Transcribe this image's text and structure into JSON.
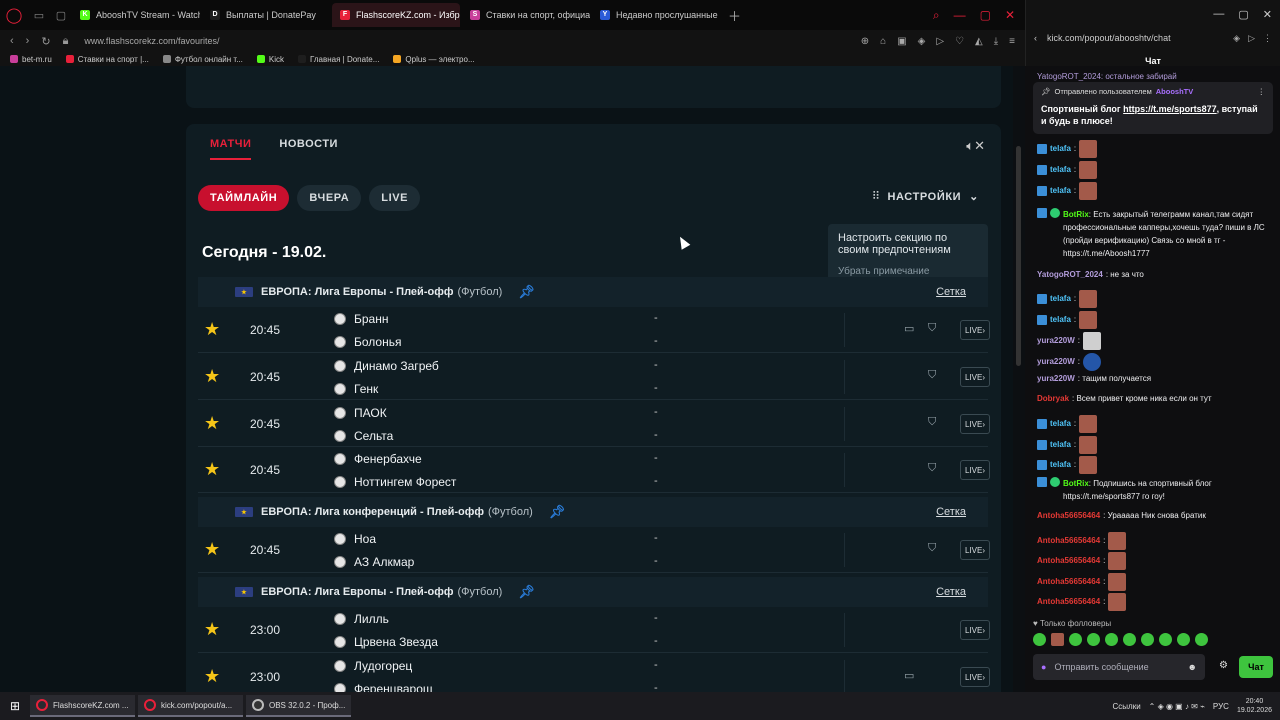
{
  "browser": {
    "tabs": [
      {
        "label": "AbooshTV Stream - Watch",
        "color": "#53fc18",
        "fav": "K"
      },
      {
        "label": "Выплаты | DonatePay",
        "color": "#1e1e1e",
        "fav": "D"
      },
      {
        "label": "FlashscoreKZ.com - Избр",
        "color": "#e8203a",
        "fav": "F",
        "active": true
      },
      {
        "label": "Ставки на спорт, официа",
        "color": "#c83e9a",
        "fav": "S"
      },
      {
        "label": "Недавно прослушанные",
        "color": "#2a5bd8",
        "fav": "Y"
      }
    ],
    "url": "www.flashscorekz.com/favourites/",
    "bookmarks": [
      {
        "label": "bet-m.ru",
        "color": "#c83e9a"
      },
      {
        "label": "Ставки на спорт |...",
        "color": "#e8203a"
      },
      {
        "label": "Футбол онлайн т...",
        "color": "#888888"
      },
      {
        "label": "Kick",
        "color": "#53fc18"
      },
      {
        "label": "Главная | Donate...",
        "color": "#1e1e1e"
      },
      {
        "label": "Qplus — электро...",
        "color": "#f5a623"
      }
    ]
  },
  "chat_window": {
    "url": "kick.com/popout/abooshtv/chat",
    "title": "Чат"
  },
  "page": {
    "main_tabs": [
      "МАТЧИ",
      "НОВОСТИ"
    ],
    "pills": [
      "ТАЙМЛАЙН",
      "ВЧЕРА",
      "LIVE"
    ],
    "settings_label": "НАСТРОЙКИ",
    "tooltip": {
      "text": "Настроить секцию по своим предпочтениям",
      "dismiss": "Убрать примечание"
    },
    "date": "Сегодня - 19.02.",
    "grid_label": "Сетка",
    "live_label": "LIVE",
    "leagues": [
      {
        "name": "ЕВРОПА: Лига Европы - Плей-офф",
        "sport": "(Футбол)"
      },
      {
        "name": "ЕВРОПА: Лига конференций - Плей-офф",
        "sport": "(Футбол)"
      },
      {
        "name": "ЕВРОПА: Лига Европы - Плей-офф",
        "sport": "(Футбол)"
      }
    ],
    "matches": [
      {
        "time": "20:45",
        "home": "Бранн",
        "away": "Болонья",
        "s1": "-",
        "s2": "-",
        "tv": true,
        "shirt": true
      },
      {
        "time": "20:45",
        "home": "Динамо Загреб",
        "away": "Генк",
        "s1": "-",
        "s2": "-",
        "tv": false,
        "shirt": true
      },
      {
        "time": "20:45",
        "home": "ПАОК",
        "away": "Сельта",
        "s1": "-",
        "s2": "-",
        "tv": false,
        "shirt": true
      },
      {
        "time": "20:45",
        "home": "Фенербахче",
        "away": "Ноттингем Форест",
        "s1": "-",
        "s2": "-",
        "tv": false,
        "shirt": true
      },
      {
        "time": "20:45",
        "home": "Ноа",
        "away": "АЗ Алкмар",
        "s1": "-",
        "s2": "-",
        "tv": false,
        "shirt": true
      },
      {
        "time": "23:00",
        "home": "Лилль",
        "away": "Црвена Звезда",
        "s1": "-",
        "s2": "-",
        "tv": false,
        "shirt": false
      },
      {
        "time": "23:00",
        "home": "Лудогорец",
        "away": "Ференцварош",
        "s1": "-",
        "s2": "-",
        "tv": true,
        "shirt": false
      }
    ]
  },
  "chat": {
    "pinned_header": "Отправлено пользователем",
    "pinned_user": "AbooshTV",
    "pinned_text": "Спортивный блог",
    "pinned_link": "https://t.me/sports877",
    "pinned_tail": ", вступай и будь в плюсе!",
    "messages": [
      {
        "user": "telafa",
        "color": "#4fc3f7",
        "text": ":",
        "emote": "r"
      },
      {
        "user": "telafa",
        "color": "#4fc3f7",
        "text": ":",
        "emote": "r"
      },
      {
        "user": "telafa",
        "color": "#4fc3f7",
        "text": ":",
        "emote": "r"
      },
      {
        "user": "BotRix",
        "color": "#53fc18",
        "text": ": Есть закрытый телеграмм канал,там сидят профессиональные капперы,хочешь туда? пиши в ЛС (пройди верификацию) Связь со мной в тг - https://t.me/Aboosh1777"
      },
      {
        "user": "YatogoROT_2024",
        "color": "#b39ddb",
        "text": ": не за что"
      },
      {
        "user": "telafa",
        "color": "#4fc3f7",
        "text": ":",
        "emote": "r"
      },
      {
        "user": "telafa",
        "color": "#4fc3f7",
        "text": ":",
        "emote": "r"
      },
      {
        "user": "yura220W",
        "color": "#b39ddb",
        "text": ":",
        "emote": "w"
      },
      {
        "user": "yura220W",
        "color": "#b39ddb",
        "text": ":",
        "emote": "b"
      },
      {
        "user": "yura220W",
        "color": "#b39ddb",
        "text": ": тащим получается"
      },
      {
        "user": "Dobryak",
        "color": "#e53935",
        "text": ": Всем привет кроме ника если он тут"
      },
      {
        "user": "telafa",
        "color": "#4fc3f7",
        "text": ":",
        "emote": "r"
      },
      {
        "user": "telafa",
        "color": "#4fc3f7",
        "text": ":",
        "emote": "r"
      },
      {
        "user": "telafa",
        "color": "#4fc3f7",
        "text": ":",
        "emote": "r"
      },
      {
        "user": "BotRix",
        "color": "#53fc18",
        "text": ": Подпишись на спортивный блог https://t.me/sports877 го гоу!"
      },
      {
        "user": "Antoha56656464",
        "color": "#e53935",
        "text": ": Урааааа Ник снова братик"
      },
      {
        "user": "Antoha56656464",
        "color": "#e53935",
        "text": ":",
        "emote": "r"
      },
      {
        "user": "Antoha56656464",
        "color": "#e53935",
        "text": ":",
        "emote": "r"
      },
      {
        "user": "Antoha56656464",
        "color": "#e53935",
        "text": ":",
        "emote": "r"
      },
      {
        "user": "Antoha56656464",
        "color": "#e53935",
        "text": ":",
        "emote": "r"
      }
    ],
    "top_partial": "YatogoROT_2024: остальное забирай",
    "followers_only": "Только фолловеры",
    "input_placeholder": "Отправить сообщение",
    "send_label": "Чат"
  },
  "taskbar": {
    "items": [
      "FlashscoreKZ.com ...",
      "kick.com/popout/a...",
      "OBS 32.0.2 - Проф..."
    ],
    "links_label": "Ссылки",
    "lang": "РУС",
    "time": "20:40",
    "date": "19.02.2026"
  }
}
